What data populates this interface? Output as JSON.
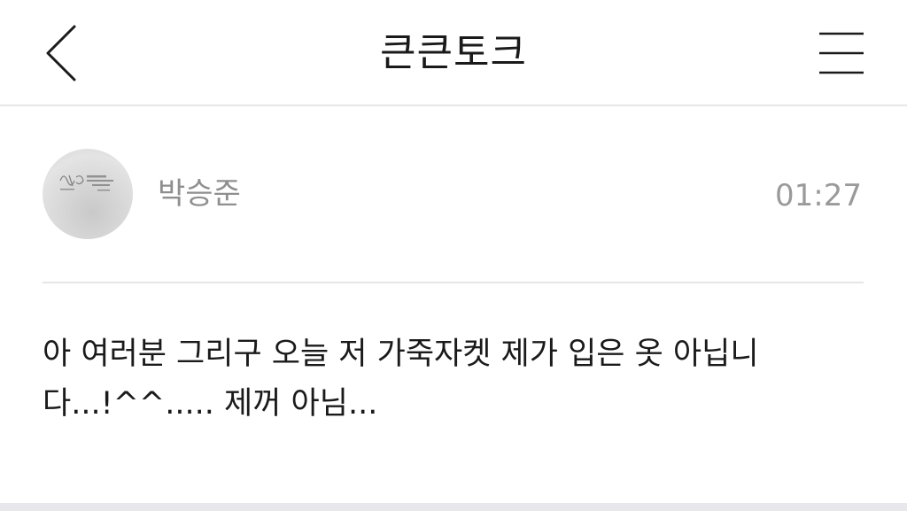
{
  "header": {
    "title": "큰큰토크"
  },
  "post": {
    "author": "박승준",
    "time": "01:27",
    "lines": [
      "아 여러분 그리구 오늘 저 가죽자켓 제가 입은 옷 아닙니",
      "다...!^^..... 제꺼 아님..."
    ]
  },
  "icons": {
    "back": "chevron-left-icon",
    "menu": "hamburger-menu-icon",
    "avatar": "profile-avatar-image"
  },
  "colors": {
    "title_text": "#1a1a1a",
    "meta_text": "#8f8f8f",
    "divider": "#e6e6e6",
    "background": "#ffffff",
    "footer_bar": "#e7e7ec"
  }
}
